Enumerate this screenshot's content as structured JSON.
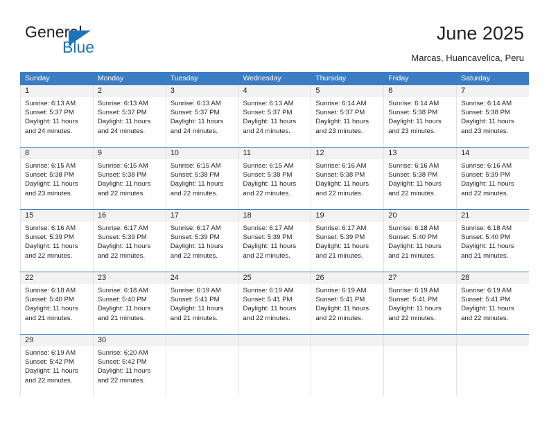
{
  "brand": {
    "name_top": "General",
    "name_bottom": "Blue",
    "accent_color": "#1b75bb"
  },
  "header": {
    "title": "June 2025",
    "subtitle": "Marcas, Huancavelica, Peru"
  },
  "calendar": {
    "header_bg": "#3b7dc4",
    "header_text_color": "#ffffff",
    "daynum_band_color": "#f2f2f2",
    "weekdays": [
      "Sunday",
      "Monday",
      "Tuesday",
      "Wednesday",
      "Thursday",
      "Friday",
      "Saturday"
    ],
    "weeks": [
      [
        {
          "day": "1",
          "sunrise": "Sunrise: 6:13 AM",
          "sunset": "Sunset: 5:37 PM",
          "daylight1": "Daylight: 11 hours",
          "daylight2": "and 24 minutes."
        },
        {
          "day": "2",
          "sunrise": "Sunrise: 6:13 AM",
          "sunset": "Sunset: 5:37 PM",
          "daylight1": "Daylight: 11 hours",
          "daylight2": "and 24 minutes."
        },
        {
          "day": "3",
          "sunrise": "Sunrise: 6:13 AM",
          "sunset": "Sunset: 5:37 PM",
          "daylight1": "Daylight: 11 hours",
          "daylight2": "and 24 minutes."
        },
        {
          "day": "4",
          "sunrise": "Sunrise: 6:13 AM",
          "sunset": "Sunset: 5:37 PM",
          "daylight1": "Daylight: 11 hours",
          "daylight2": "and 24 minutes."
        },
        {
          "day": "5",
          "sunrise": "Sunrise: 6:14 AM",
          "sunset": "Sunset: 5:37 PM",
          "daylight1": "Daylight: 11 hours",
          "daylight2": "and 23 minutes."
        },
        {
          "day": "6",
          "sunrise": "Sunrise: 6:14 AM",
          "sunset": "Sunset: 5:38 PM",
          "daylight1": "Daylight: 11 hours",
          "daylight2": "and 23 minutes."
        },
        {
          "day": "7",
          "sunrise": "Sunrise: 6:14 AM",
          "sunset": "Sunset: 5:38 PM",
          "daylight1": "Daylight: 11 hours",
          "daylight2": "and 23 minutes."
        }
      ],
      [
        {
          "day": "8",
          "sunrise": "Sunrise: 6:15 AM",
          "sunset": "Sunset: 5:38 PM",
          "daylight1": "Daylight: 11 hours",
          "daylight2": "and 23 minutes."
        },
        {
          "day": "9",
          "sunrise": "Sunrise: 6:15 AM",
          "sunset": "Sunset: 5:38 PM",
          "daylight1": "Daylight: 11 hours",
          "daylight2": "and 22 minutes."
        },
        {
          "day": "10",
          "sunrise": "Sunrise: 6:15 AM",
          "sunset": "Sunset: 5:38 PM",
          "daylight1": "Daylight: 11 hours",
          "daylight2": "and 22 minutes."
        },
        {
          "day": "11",
          "sunrise": "Sunrise: 6:15 AM",
          "sunset": "Sunset: 5:38 PM",
          "daylight1": "Daylight: 11 hours",
          "daylight2": "and 22 minutes."
        },
        {
          "day": "12",
          "sunrise": "Sunrise: 6:16 AM",
          "sunset": "Sunset: 5:38 PM",
          "daylight1": "Daylight: 11 hours",
          "daylight2": "and 22 minutes."
        },
        {
          "day": "13",
          "sunrise": "Sunrise: 6:16 AM",
          "sunset": "Sunset: 5:38 PM",
          "daylight1": "Daylight: 11 hours",
          "daylight2": "and 22 minutes."
        },
        {
          "day": "14",
          "sunrise": "Sunrise: 6:16 AM",
          "sunset": "Sunset: 5:39 PM",
          "daylight1": "Daylight: 11 hours",
          "daylight2": "and 22 minutes."
        }
      ],
      [
        {
          "day": "15",
          "sunrise": "Sunrise: 6:16 AM",
          "sunset": "Sunset: 5:39 PM",
          "daylight1": "Daylight: 11 hours",
          "daylight2": "and 22 minutes."
        },
        {
          "day": "16",
          "sunrise": "Sunrise: 6:17 AM",
          "sunset": "Sunset: 5:39 PM",
          "daylight1": "Daylight: 11 hours",
          "daylight2": "and 22 minutes."
        },
        {
          "day": "17",
          "sunrise": "Sunrise: 6:17 AM",
          "sunset": "Sunset: 5:39 PM",
          "daylight1": "Daylight: 11 hours",
          "daylight2": "and 22 minutes."
        },
        {
          "day": "18",
          "sunrise": "Sunrise: 6:17 AM",
          "sunset": "Sunset: 5:39 PM",
          "daylight1": "Daylight: 11 hours",
          "daylight2": "and 22 minutes."
        },
        {
          "day": "19",
          "sunrise": "Sunrise: 6:17 AM",
          "sunset": "Sunset: 5:39 PM",
          "daylight1": "Daylight: 11 hours",
          "daylight2": "and 21 minutes."
        },
        {
          "day": "20",
          "sunrise": "Sunrise: 6:18 AM",
          "sunset": "Sunset: 5:40 PM",
          "daylight1": "Daylight: 11 hours",
          "daylight2": "and 21 minutes."
        },
        {
          "day": "21",
          "sunrise": "Sunrise: 6:18 AM",
          "sunset": "Sunset: 5:40 PM",
          "daylight1": "Daylight: 11 hours",
          "daylight2": "and 21 minutes."
        }
      ],
      [
        {
          "day": "22",
          "sunrise": "Sunrise: 6:18 AM",
          "sunset": "Sunset: 5:40 PM",
          "daylight1": "Daylight: 11 hours",
          "daylight2": "and 21 minutes."
        },
        {
          "day": "23",
          "sunrise": "Sunrise: 6:18 AM",
          "sunset": "Sunset: 5:40 PM",
          "daylight1": "Daylight: 11 hours",
          "daylight2": "and 21 minutes."
        },
        {
          "day": "24",
          "sunrise": "Sunrise: 6:19 AM",
          "sunset": "Sunset: 5:41 PM",
          "daylight1": "Daylight: 11 hours",
          "daylight2": "and 21 minutes."
        },
        {
          "day": "25",
          "sunrise": "Sunrise: 6:19 AM",
          "sunset": "Sunset: 5:41 PM",
          "daylight1": "Daylight: 11 hours",
          "daylight2": "and 22 minutes."
        },
        {
          "day": "26",
          "sunrise": "Sunrise: 6:19 AM",
          "sunset": "Sunset: 5:41 PM",
          "daylight1": "Daylight: 11 hours",
          "daylight2": "and 22 minutes."
        },
        {
          "day": "27",
          "sunrise": "Sunrise: 6:19 AM",
          "sunset": "Sunset: 5:41 PM",
          "daylight1": "Daylight: 11 hours",
          "daylight2": "and 22 minutes."
        },
        {
          "day": "28",
          "sunrise": "Sunrise: 6:19 AM",
          "sunset": "Sunset: 5:41 PM",
          "daylight1": "Daylight: 11 hours",
          "daylight2": "and 22 minutes."
        }
      ],
      [
        {
          "day": "29",
          "sunrise": "Sunrise: 6:19 AM",
          "sunset": "Sunset: 5:42 PM",
          "daylight1": "Daylight: 11 hours",
          "daylight2": "and 22 minutes."
        },
        {
          "day": "30",
          "sunrise": "Sunrise: 6:20 AM",
          "sunset": "Sunset: 5:42 PM",
          "daylight1": "Daylight: 11 hours",
          "daylight2": "and 22 minutes."
        },
        {
          "day": "",
          "sunrise": "",
          "sunset": "",
          "daylight1": "",
          "daylight2": ""
        },
        {
          "day": "",
          "sunrise": "",
          "sunset": "",
          "daylight1": "",
          "daylight2": ""
        },
        {
          "day": "",
          "sunrise": "",
          "sunset": "",
          "daylight1": "",
          "daylight2": ""
        },
        {
          "day": "",
          "sunrise": "",
          "sunset": "",
          "daylight1": "",
          "daylight2": ""
        },
        {
          "day": "",
          "sunrise": "",
          "sunset": "",
          "daylight1": "",
          "daylight2": ""
        }
      ]
    ]
  }
}
